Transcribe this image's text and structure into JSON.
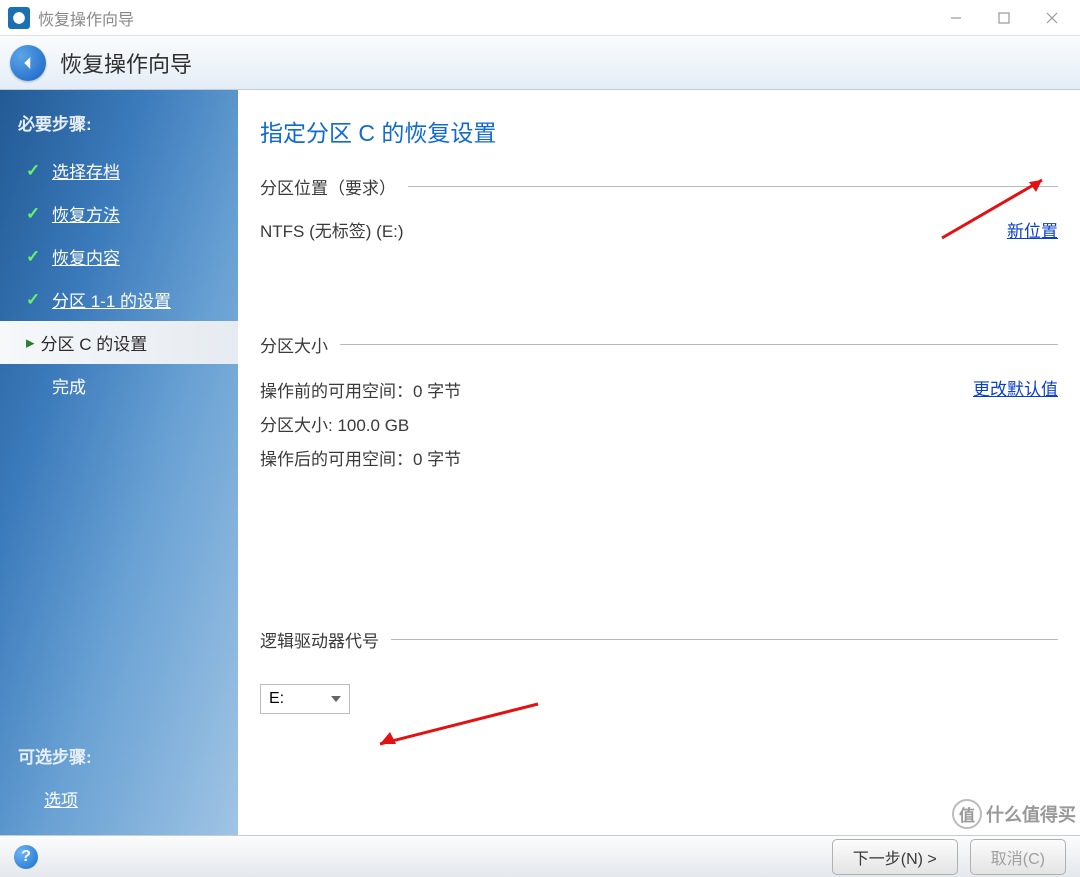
{
  "window": {
    "title": "恢复操作向导"
  },
  "header": {
    "title": "恢复操作向导"
  },
  "sidebar": {
    "required_title": "必要步骤:",
    "steps": [
      {
        "label": "选择存档",
        "status": "done"
      },
      {
        "label": "恢复方法",
        "status": "done"
      },
      {
        "label": "恢复内容",
        "status": "done"
      },
      {
        "label": "分区 1-1 的设置",
        "status": "done"
      },
      {
        "label": "分区 C 的设置",
        "status": "current"
      },
      {
        "label": "完成",
        "status": "future"
      }
    ],
    "optional_title": "可选步骤:",
    "optional_item": "选项"
  },
  "content": {
    "page_title": "指定分区 C 的恢复设置",
    "location_section": "分区位置（要求）",
    "location_value": "NTFS (无标签) (E:)",
    "new_location_link": "新位置",
    "size_section": "分区大小",
    "before_space": "操作前的可用空间：0 字节",
    "partition_size": "分区大小: 100.0 GB",
    "after_space": "操作后的可用空间：0 字节",
    "change_default_link": "更改默认值",
    "drive_letter_section": "逻辑驱动器代号",
    "drive_value": "E:"
  },
  "footer": {
    "next": "下一步(N) >",
    "cancel": "取消(C)"
  },
  "watermark": {
    "icon": "值",
    "text": "什么值得买"
  }
}
